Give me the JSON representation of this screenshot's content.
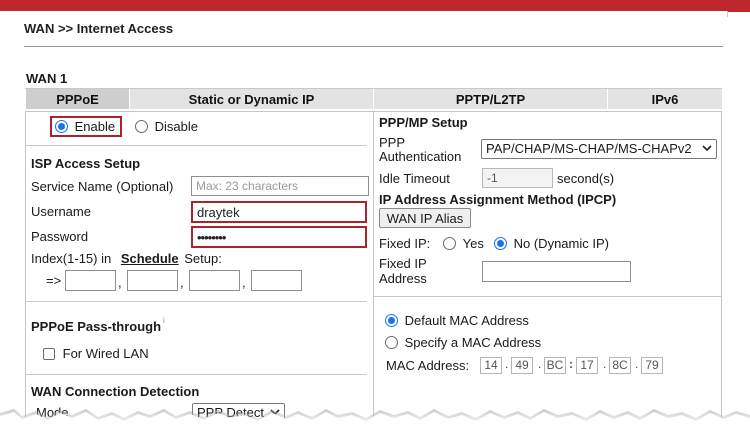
{
  "page": {
    "breadcrumb": "WAN >> Internet Access",
    "section_title": "WAN 1"
  },
  "tabs": [
    {
      "label": "PPPoE",
      "active": true
    },
    {
      "label": "Static or Dynamic IP",
      "active": false
    },
    {
      "label": "PPTP/L2TP",
      "active": false
    },
    {
      "label": "IPv6",
      "active": false
    }
  ],
  "left": {
    "enable_label": "Enable",
    "disable_label": "Disable",
    "enabled": true,
    "isp_heading": "ISP Access Setup",
    "service_name_label": "Service Name (Optional)",
    "service_name_placeholder": "Max: 23 characters",
    "username_label": "Username",
    "username_value": "draytek",
    "password_label": "Password",
    "password_value": "••••••••",
    "index_prefix": "Index(1-15) in",
    "schedule_link": "Schedule",
    "index_suffix": "Setup:",
    "arrow": "=>",
    "comma": ",",
    "passthrough_heading": "PPPoE Pass-through",
    "passthrough_mark": "i",
    "wired_lan_label": "For Wired LAN",
    "wcd_heading": "WAN Connection Detection",
    "mode_label": "Mode",
    "mode_value": "PPP Detect"
  },
  "right": {
    "pppmp_heading": "PPP/MP Setup",
    "auth_label_1": "PPP",
    "auth_label_2": "Authentication",
    "auth_value": "PAP/CHAP/MS-CHAP/MS-CHAPv2",
    "idle_label": "Idle Timeout",
    "idle_value": "-1",
    "idle_unit": "second(s)",
    "ipcp_heading": "IP Address Assignment Method (IPCP)",
    "wan_alias_button": "WAN IP Alias",
    "fixed_ip_label": "Fixed IP:",
    "yes_label": "Yes",
    "no_label": "No (Dynamic IP)",
    "fixed_addr_label_1": "Fixed IP",
    "fixed_addr_label_2": "Address",
    "default_mac_label": "Default MAC Address",
    "specify_mac_label": "Specify a MAC Address",
    "mac_label": "MAC Address:",
    "mac_octets": [
      "14",
      "49",
      "BC",
      "17",
      "8C",
      "79"
    ],
    "mac_separators": [
      ".",
      ".",
      ":",
      ".",
      "."
    ]
  },
  "colors": {
    "accent": "#c0282d",
    "highlight_border": "#a8232a",
    "radio_selected": "#1a73e8",
    "active_tab": "#cfcfcf",
    "inactive_tab": "#e3e3e3"
  }
}
